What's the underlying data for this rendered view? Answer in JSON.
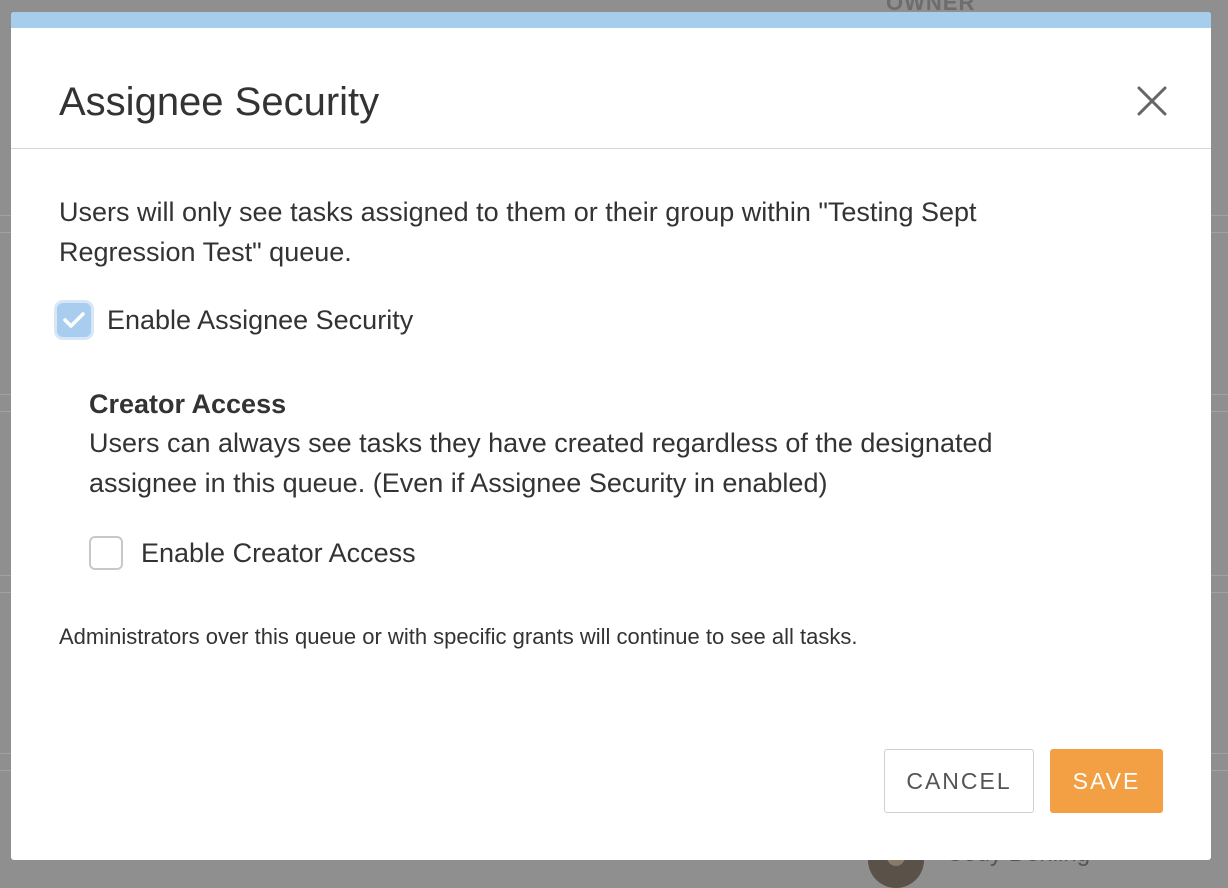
{
  "background": {
    "owner_header": "OWNER",
    "user_name": "Cody Dehling"
  },
  "modal": {
    "title": "Assignee Security",
    "description": "Users will only see tasks assigned to them or their group within \"Testing Sept Regression Test\" queue.",
    "enable_assignee_security": {
      "label": "Enable Assignee Security",
      "checked": true
    },
    "creator_access": {
      "title": "Creator Access",
      "description": "Users can always see tasks they have created regardless of the designated assignee in this queue. (Even if Assignee Security in enabled)",
      "enable_creator_access": {
        "label": "Enable Creator Access",
        "checked": false
      }
    },
    "admin_note": "Administrators over this queue or with specific grants will continue to see all tasks.",
    "buttons": {
      "cancel": "CANCEL",
      "save": "SAVE"
    }
  },
  "colors": {
    "accent_save": "#f2a043",
    "checkbox_checked": "#a9cdee",
    "header_bar": "#a7cdec",
    "overlay": "#8f8f8f"
  },
  "icons": {
    "close": "close-icon",
    "check": "checkmark-icon"
  }
}
